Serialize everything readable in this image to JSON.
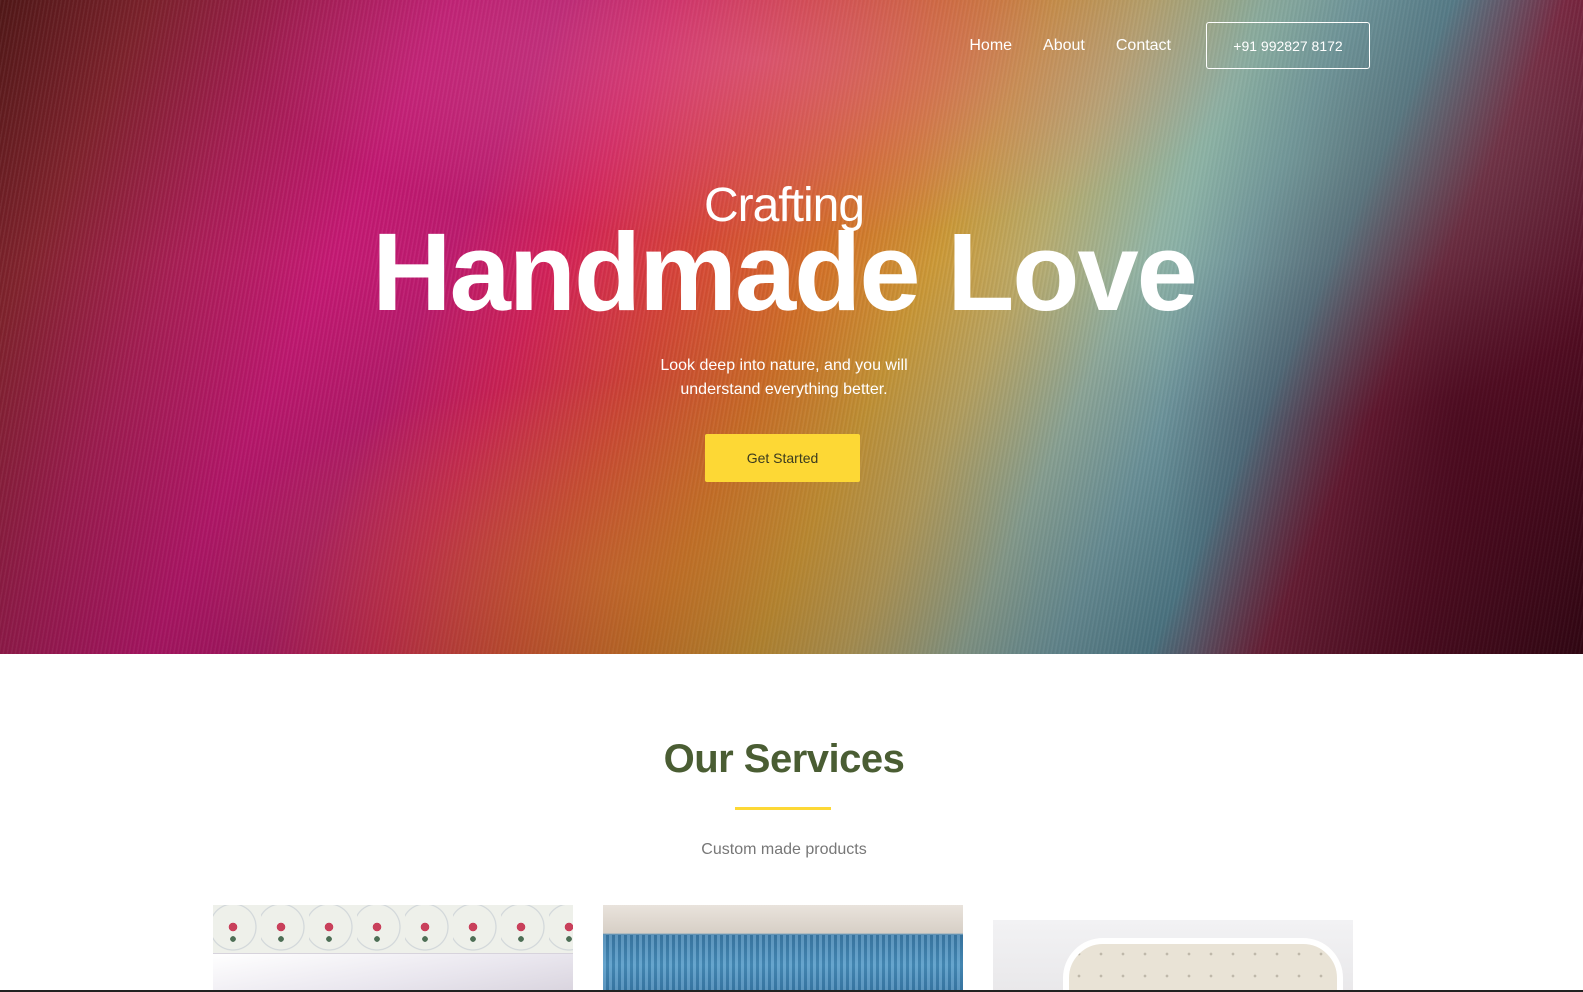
{
  "nav": {
    "links": [
      {
        "label": "Home"
      },
      {
        "label": "About"
      },
      {
        "label": "Contact"
      }
    ],
    "phone": "+91 992827 8172"
  },
  "hero": {
    "pre_title": "Crafting",
    "title": "Handmade Love",
    "subtitle_line1": "Look deep into nature, and you will",
    "subtitle_line2": "understand everything better.",
    "cta_label": "Get Started"
  },
  "services": {
    "title": "Our Services",
    "subtitle": "Custom made products",
    "cards": [
      {
        "image": "floral-print-fabric"
      },
      {
        "image": "blue-knit-blanket"
      },
      {
        "image": "tufted-headboard"
      }
    ]
  },
  "colors": {
    "accent": "#fdd835",
    "heading": "#4a5d33"
  }
}
